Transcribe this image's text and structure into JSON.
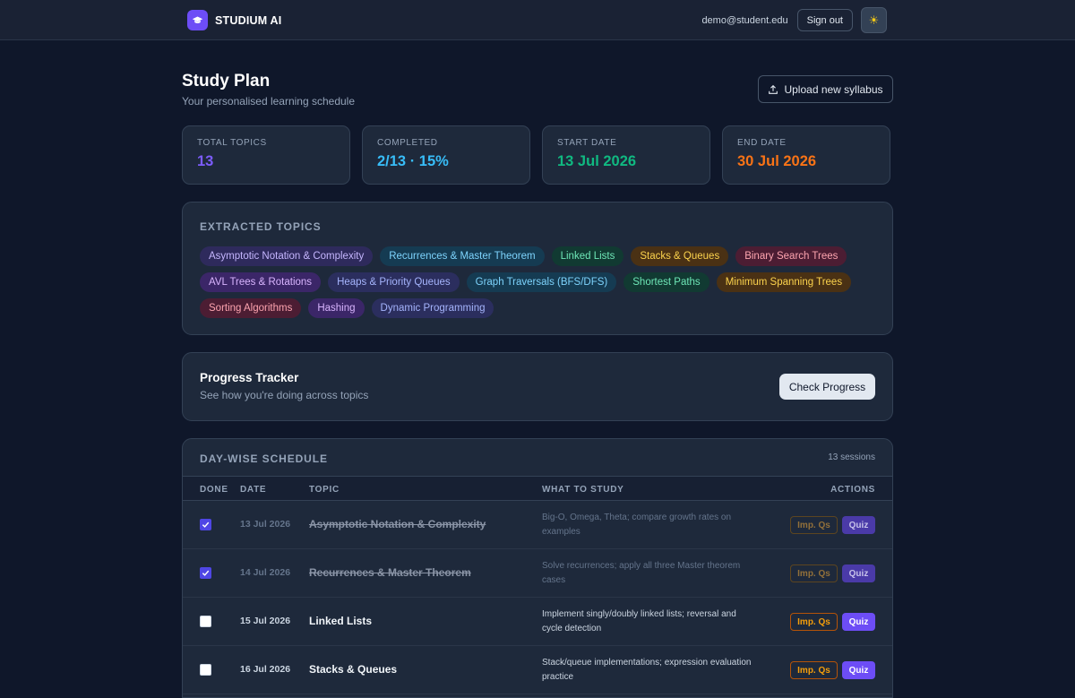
{
  "nav": {
    "brand": "STUDIUM AI",
    "email": "demo@student.edu",
    "sign_out": "Sign out",
    "theme_icon": "sun-icon"
  },
  "header": {
    "title": "Study Plan",
    "subtitle": "Your personalised learning schedule",
    "upload_label": "Upload new syllabus"
  },
  "stats": [
    {
      "label": "TOTAL TOPICS",
      "value": "13",
      "color": "#7c5cfc"
    },
    {
      "label": "COMPLETED",
      "value": "2/13 · 15%",
      "color": "#38bdf8"
    },
    {
      "label": "START DATE",
      "value": "13 Jul 2026",
      "color": "#10b981"
    },
    {
      "label": "END DATE",
      "value": "30 Jul 2026",
      "color": "#f97316"
    }
  ],
  "topics": {
    "heading": "EXTRACTED TOPICS",
    "chips": [
      {
        "label": "Asymptotic Notation & Complexity",
        "tone": "violet"
      },
      {
        "label": "Recurrences & Master Theorem",
        "tone": "cyan"
      },
      {
        "label": "Linked Lists",
        "tone": "green"
      },
      {
        "label": "Stacks & Queues",
        "tone": "amber"
      },
      {
        "label": "Binary Search Trees",
        "tone": "rose"
      },
      {
        "label": "AVL Trees & Rotations",
        "tone": "purple"
      },
      {
        "label": "Heaps & Priority Queues",
        "tone": "indigo"
      },
      {
        "label": "Graph Traversals (BFS/DFS)",
        "tone": "cyan"
      },
      {
        "label": "Shortest Paths",
        "tone": "green"
      },
      {
        "label": "Minimum Spanning Trees",
        "tone": "amber"
      },
      {
        "label": "Sorting Algorithms",
        "tone": "rose"
      },
      {
        "label": "Hashing",
        "tone": "purple"
      },
      {
        "label": "Dynamic Programming",
        "tone": "indigo"
      }
    ]
  },
  "progress": {
    "title": "Progress Tracker",
    "subtitle": "See how you're doing across topics",
    "button": "Check Progress"
  },
  "schedule": {
    "heading": "DAY-WISE SCHEDULE",
    "sessions": "13 sessions",
    "columns": {
      "done": "DONE",
      "date": "DATE",
      "topic": "TOPIC",
      "what": "WHAT TO STUDY",
      "actions": "ACTIONS"
    },
    "imp_label": "Imp. Qs",
    "quiz_label": "Quiz",
    "rows": [
      {
        "done": true,
        "date": "13 Jul 2026",
        "topic": "Asymptotic Notation & Complexity",
        "what": "Big-O, Omega, Theta; compare growth rates on examples"
      },
      {
        "done": true,
        "date": "14 Jul 2026",
        "topic": "Recurrences & Master Theorem",
        "what": "Solve recurrences; apply all three Master theorem cases"
      },
      {
        "done": false,
        "date": "15 Jul 2026",
        "topic": "Linked Lists",
        "what": "Implement singly/doubly linked lists; reversal and cycle detection"
      },
      {
        "done": false,
        "date": "16 Jul 2026",
        "topic": "Stacks & Queues",
        "what": "Stack/queue implementations; expression evaluation practice"
      }
    ]
  }
}
